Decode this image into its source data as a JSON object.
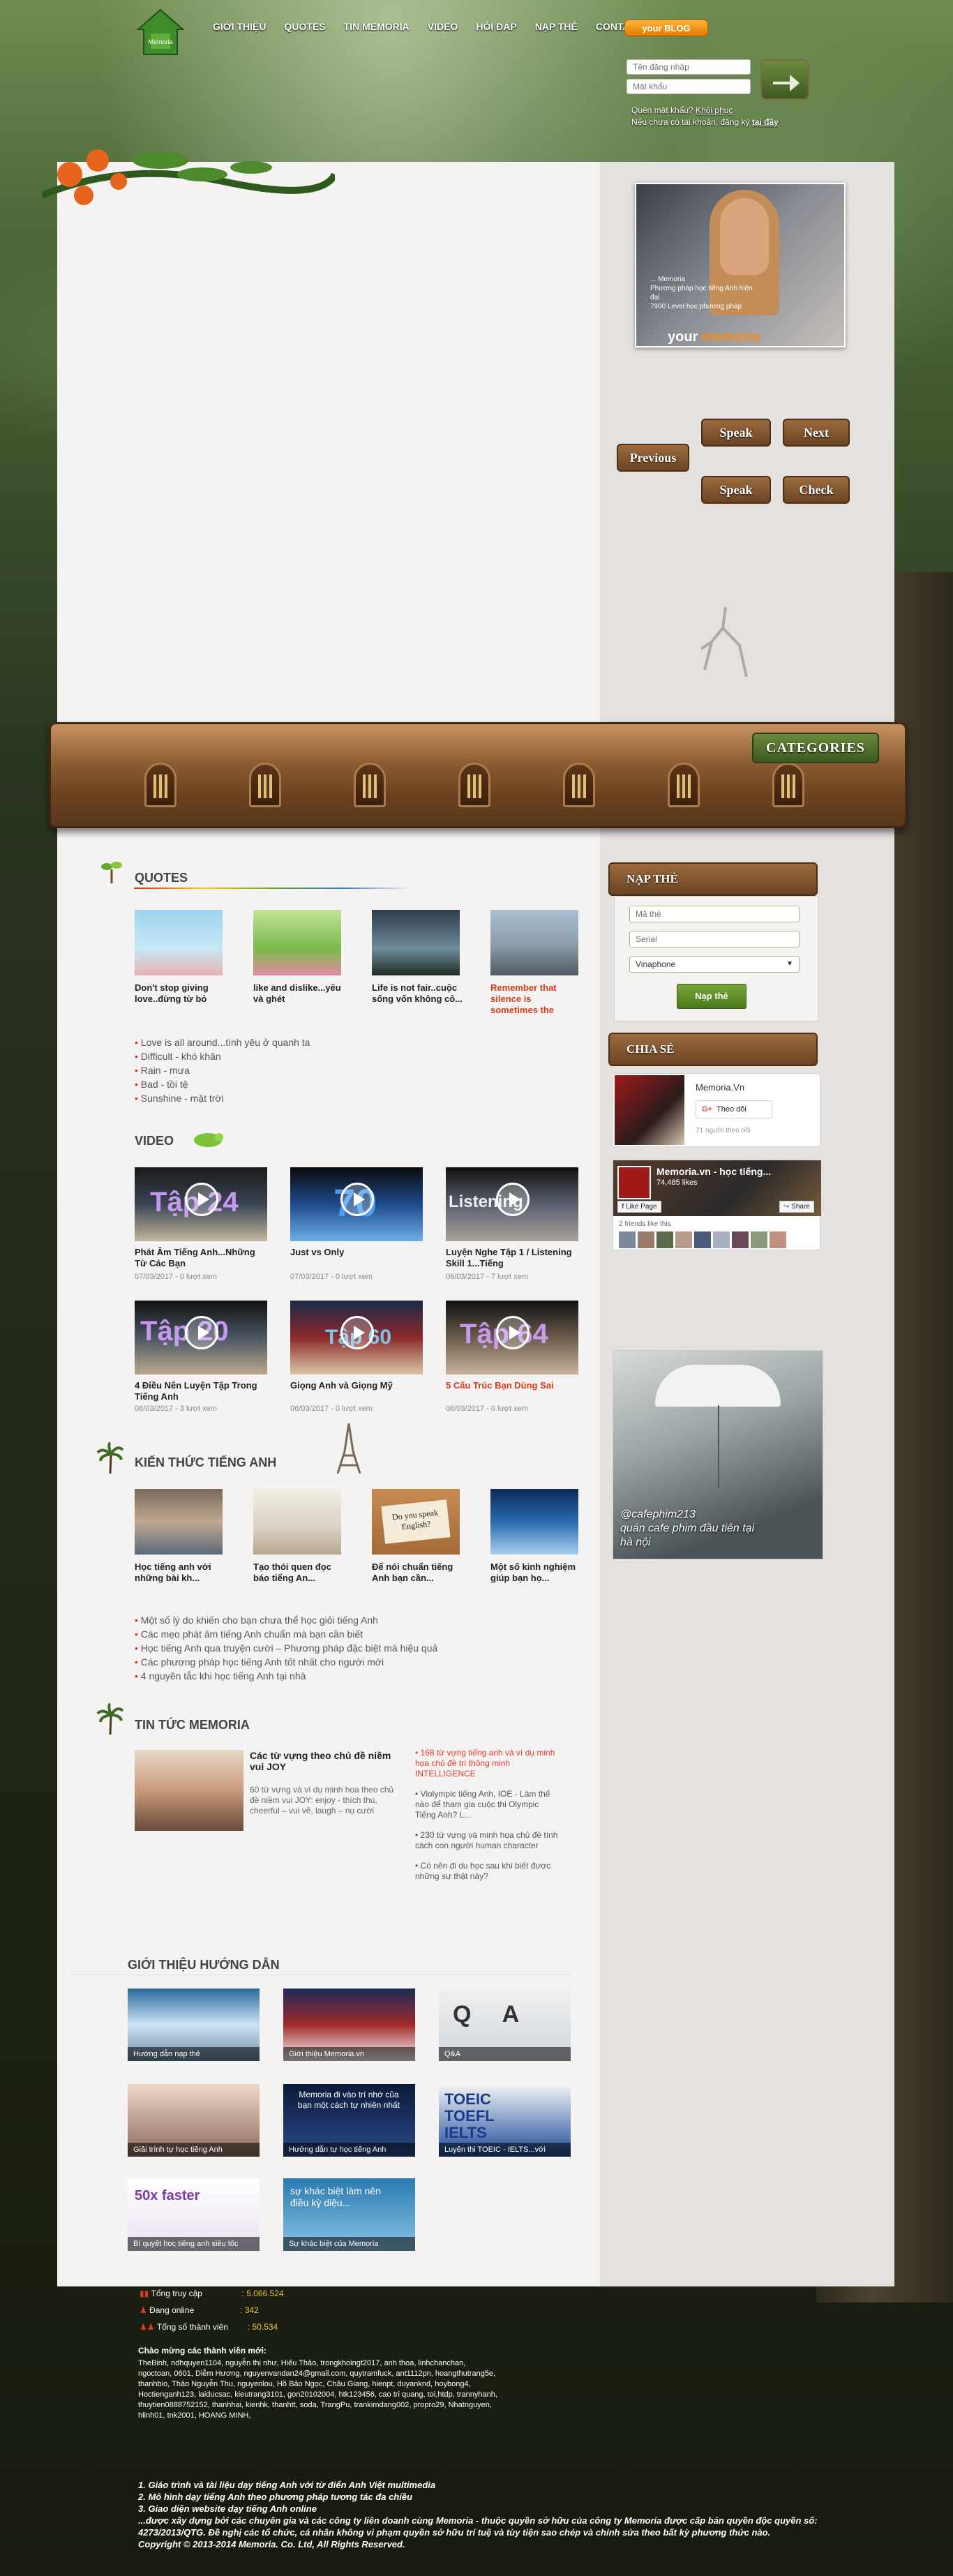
{
  "nav": {
    "items": [
      "GIỚI THIỆU",
      "QUOTES",
      "TIN MEMORIA",
      "VIDEO",
      "HỎI ĐÁP",
      "NẠP THẺ",
      "CONTACT"
    ],
    "blog_button": "your BLOG"
  },
  "login": {
    "username_placeholder": "Tên đăng nhập",
    "password_placeholder": "Mật khẩu",
    "forgot_prefix": "Quên mật khẩu?",
    "forgot_link": "Khôi phục",
    "register_prefix": "Nếu chưa có tài khoản, đăng ký",
    "register_link": "tại đây"
  },
  "slider": {
    "caption": "... Memoria\nPhương pháp học tiếng Anh hiện đại\n7900 Level học phương pháp",
    "brand_a": "your",
    "brand_b": "memoria"
  },
  "signs": {
    "speak": "Speak",
    "next": "Next",
    "previous": "Previous",
    "check": "Check"
  },
  "categories": {
    "title": "CATEGORIES"
  },
  "quotes": {
    "title": "QUOTES",
    "items": [
      {
        "title": "Don't stop giving love..đừng từ bỏ",
        "red": false
      },
      {
        "title": "like and dislike...yêu và ghét",
        "red": false
      },
      {
        "title": "Life is not fair..cuộc sống vốn không cô...",
        "red": false
      },
      {
        "title": "Remember that silence is sometimes the",
        "red": true
      }
    ],
    "list": [
      "Love is all around...tình yêu ở quanh ta",
      "Difficult - khó khăn",
      "Rain - mưa",
      "Bad - tồi tệ",
      "Sunshine - mặt trời"
    ]
  },
  "video": {
    "title": "VIDEO",
    "items": [
      {
        "title": "Phát Âm Tiếng Anh...Những Từ Các Bạn",
        "meta": "07/03/2017 - 0 lượt xem",
        "num": "Tập 24",
        "red": false
      },
      {
        "title": "Just vs Only",
        "meta": "07/03/2017 - 0 lượt xem",
        "num": "70",
        "red": false
      },
      {
        "title": "Luyện Nghe Tập 1 / Listening Skill 1...Tiếng",
        "meta": "06/03/2017 - 7 lượt xem",
        "num": "Listening",
        "red": false
      },
      {
        "title": "4 Điều Nên Luyện Tập Trong Tiếng Anh",
        "meta": "06/03/2017 - 3 lượt xem",
        "num": "Tập 20",
        "red": false
      },
      {
        "title": "Giọng Anh và Giọng Mỹ",
        "meta": "06/03/2017 - 0 lượt xem",
        "num": "Tập 60",
        "red": false
      },
      {
        "title": "5 Cấu Trúc Bạn Dùng Sai",
        "meta": "06/03/2017 - 0 lượt xem",
        "num": "Tập 64",
        "red": true
      }
    ]
  },
  "knowledge": {
    "title": "KIẾN THỨC TIẾNG ANH",
    "items": [
      {
        "title": "Học tiếng anh với những bài kh..."
      },
      {
        "title": "Tạo thói quen đọc báo tiếng An..."
      },
      {
        "title": "Để nói chuẩn tiếng Anh bạn cần..."
      },
      {
        "title": "Một số kinh nghiệm giúp bạn họ..."
      }
    ],
    "thumb_text": "Do you speak English?",
    "list": [
      "Một số lý do khiến cho bạn chưa thể học giỏi tiếng Anh",
      "Các mẹo phát âm tiếng Anh chuẩn mà bạn cần biết",
      "Học tiếng Anh qua truyện cười – Phương pháp đặc biệt mà hiệu quả",
      "Các phương pháp học tiếng Anh tốt nhất cho người mới",
      "4 nguyên tắc khi học tiếng Anh tại nhà"
    ]
  },
  "news": {
    "title": "TIN TỨC MEMORIA",
    "featured_title": "Các từ vựng theo chủ đề niềm vui JOY",
    "featured_desc": "60 từ vựng và ví dụ minh họa theo chủ đề niềm vui JOY: enjoy - thích thú, cheerful – vui vẻ, laugh – nụ cười",
    "items": [
      {
        "text": "168 từ vựng tiếng anh và ví dụ minh họa chủ đề trí thông minh INTELLIGENCE",
        "red": true
      },
      {
        "text": "Violympic tiếng Anh, IOE - Làm thế nào để tham gia cuộc thi Olympic Tiếng Anh? L...",
        "red": false
      },
      {
        "text": "230 từ vựng và minh họa chủ đề tính cách con người human character",
        "red": false
      },
      {
        "text": "Có nên đi du học sau khi biết được những sự thật này?",
        "red": false
      }
    ]
  },
  "guide": {
    "title": "GIỚI THIỆU HƯỚNG DẪN",
    "items": [
      {
        "label": "Hướng dẫn nạp thẻ",
        "overlay": ""
      },
      {
        "label": "Giới thiệu Memoria.vn",
        "overlay": ""
      },
      {
        "label": "Q&A",
        "overlay": "Q A"
      },
      {
        "label": "Giải trình tự học tiếng Anh",
        "overlay": ""
      },
      {
        "label": "Hướng dẫn tự học tiếng Anh",
        "overlay": "Memoria đi vào trí nhớ của bạn một cách tự nhiên nhất"
      },
      {
        "label": "Luyện thi TOEIC - IELTS...với",
        "overlay": "TOEIC TOEFL IELTS"
      },
      {
        "label": "Bí quyết học tiếng anh siêu tốc",
        "overlay": "50x faster"
      },
      {
        "label": "Sự khác biệt của Memoria",
        "overlay": "sự khác biệt làm nên điều kỳ diệu..."
      }
    ]
  },
  "napthe": {
    "title": "NẠP THẺ",
    "card_placeholder": "Mã thẻ",
    "serial_placeholder": "Serial",
    "provider": "Vinaphone",
    "submit": "Nạp thẻ"
  },
  "share": {
    "title": "CHIA SẺ",
    "gplus_name": "Memoria.Vn",
    "gplus_button": "Theo dõi",
    "gplus_followers": "71 người theo dõi",
    "fb_name": "Memoria.vn - học tiếng...",
    "fb_likes": "74,485 likes",
    "fb_like_button": "Like Page",
    "fb_share_button": "Share",
    "fb_friends": "2 friends like this"
  },
  "ad": {
    "text": "@cafephim213\nquán cafe phim đầu tiên tại hà nội"
  },
  "footer": {
    "stats": [
      {
        "label": "Tổng truy cập",
        "value": ": 5.066.524"
      },
      {
        "label": "Đang online",
        "value": ": 342"
      },
      {
        "label": "Tổng số thành viên",
        "value": ": 50.534"
      }
    ],
    "welcome_title": "Chào mừng các thành viên mới:",
    "welcome_users": "TheBinh, ndhquyen1104, nguyễn thị như, Hiếu Thảo, trongkhoingt2017, anh thoa, linhchanchan, ngoctoan, 0601, Diễm Hương, nguyenvandan24@gmail.com, quytramfuck, ant1112pn, hoangthutrang5e, thanhbio, Thảo Nguyễn Thu, nguyenlou, Hồ Bảo Ngọc, Châu Giang, hienpt, duyanknd, hoybong4, Hoctienganh123, laiducsac, kieutrang3101, gon20102004, htk123456, cao tri quang, toi,htdp, trannyhanh, thuytien0888752152, thanhhai, kienhk, thanhtt, soda, TrangPu, trankimdang002, propro29, Nhatnguyen, hlinh01, tnk2001, HOANG MINH,",
    "info": [
      "1. Giáo trình và tài liệu dạy tiếng Anh với từ điển Anh Việt multimedia",
      "2. Mô hình dạy tiếng Anh theo phương pháp tương tác đa chiều",
      "3. Giao diện website dạy tiếng Anh online",
      "...được xây dựng bởi các chuyên gia và các công ty liên doanh cùng Memoria - thuộc quyền sở hữu của công ty Memoria được cấp bản quyền độc quyền số: 4273/2013/QTG. Đề nghị các tổ chức, cá nhân không vi phạm quyền sở hữu trí tuệ và tùy tiện sao chép và chỉnh sửa theo bất kỳ phương thức nào.",
      "Copyright © 2013-2014 Memoria. Co. Ltd, All Rights Reserved."
    ]
  }
}
